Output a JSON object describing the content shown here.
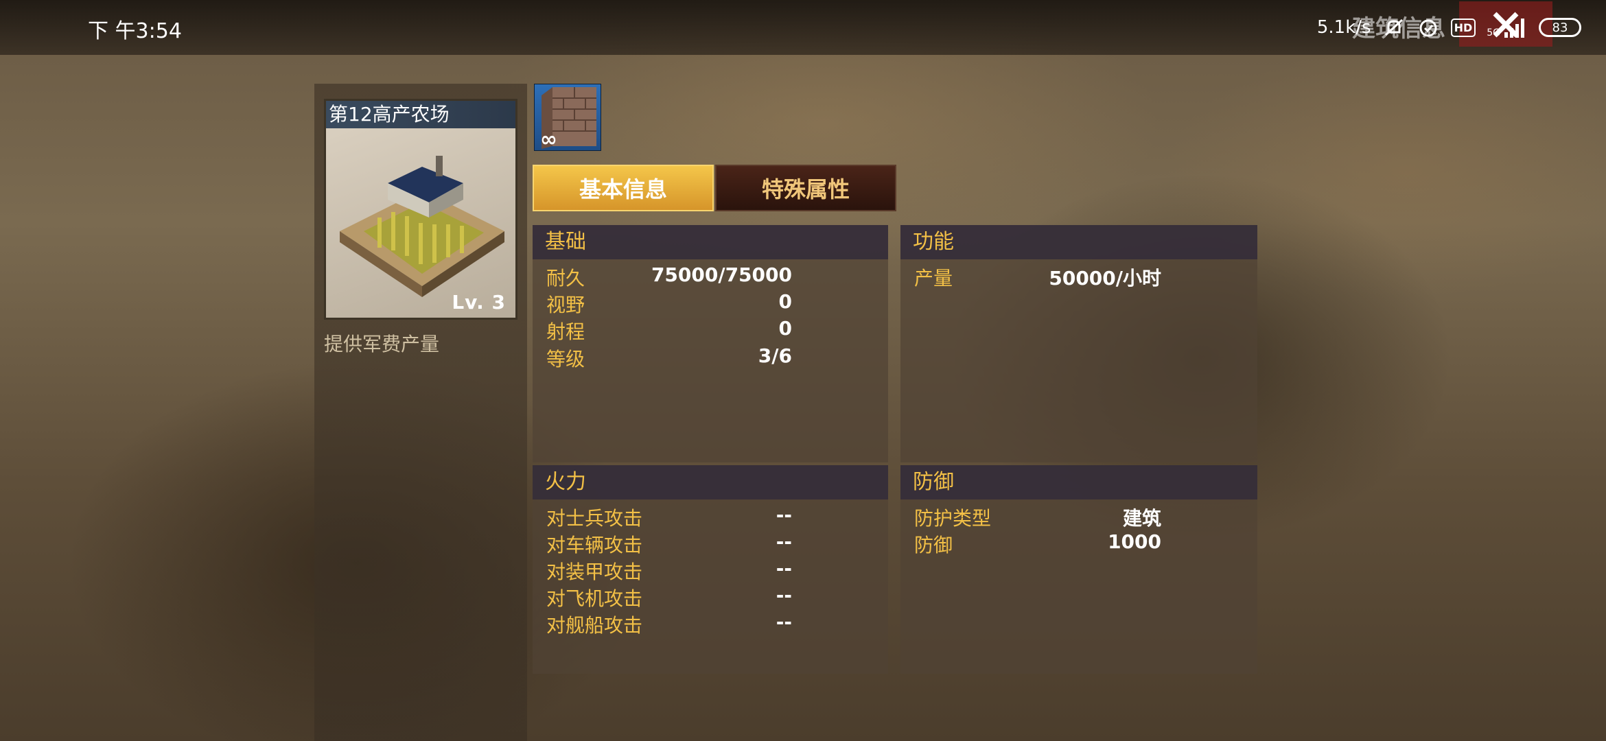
{
  "status_bar": {
    "time": "下 午3:54",
    "network_speed": "5.1k/s",
    "signal_label": "5G",
    "hd_label": "HD",
    "battery": "83",
    "title": "建筑信息"
  },
  "building": {
    "name": "第12高产农场",
    "level_label": "Lv. 3",
    "description": "提供军费产量"
  },
  "material_icon": {
    "symbol": "∞",
    "icon": "brick-wall-icon"
  },
  "tabs": [
    {
      "label": "基本信息",
      "active": true
    },
    {
      "label": "特殊属性",
      "active": false
    }
  ],
  "sections": {
    "basic": {
      "title": "基础",
      "rows": [
        {
          "label": "耐久",
          "value": "75000/75000"
        },
        {
          "label": "视野",
          "value": "0"
        },
        {
          "label": "射程",
          "value": "0"
        },
        {
          "label": "等级",
          "value": "3/6"
        }
      ]
    },
    "function": {
      "title": "功能",
      "rows": [
        {
          "label": "产量",
          "value": "50000/小时"
        }
      ]
    },
    "firepower": {
      "title": "火力",
      "rows": [
        {
          "label": "对士兵攻击",
          "value": "--"
        },
        {
          "label": "对车辆攻击",
          "value": "--"
        },
        {
          "label": "对装甲攻击",
          "value": "--"
        },
        {
          "label": "对飞机攻击",
          "value": "--"
        },
        {
          "label": "对舰船攻击",
          "value": "--"
        }
      ]
    },
    "defense": {
      "title": "防御",
      "rows": [
        {
          "label": "防护类型",
          "value": "建筑"
        },
        {
          "label": "防御",
          "value": "1000"
        }
      ]
    }
  },
  "colors": {
    "accent": "#f3c046",
    "tab_active": "#e8ae38",
    "tab_inactive": "#3a1c12"
  }
}
